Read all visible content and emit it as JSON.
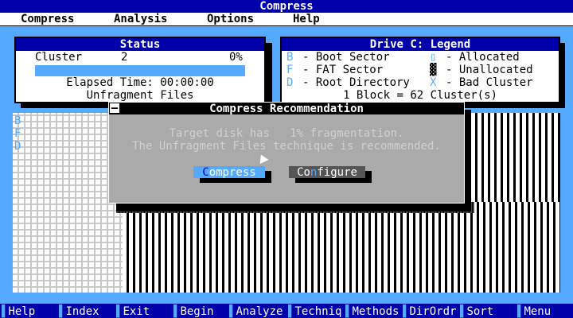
{
  "window": {
    "title": "Compress"
  },
  "menu": [
    {
      "label": "Compress"
    },
    {
      "label": "Analysis"
    },
    {
      "label": "Options"
    },
    {
      "label": "Help"
    }
  ],
  "status_panel": {
    "title": "Status",
    "cluster_label": "Cluster",
    "cluster_value": "2",
    "percent": "0%",
    "elapsed": "Elapsed Time: 00:00:00",
    "technique": "Unfragment Files"
  },
  "legend_panel": {
    "title": "Drive C: Legend",
    "items": [
      {
        "symbol": "B",
        "label": "- Boot Sector"
      },
      {
        "symbol": "F",
        "label": "- FAT Sector"
      },
      {
        "symbol": "D",
        "label": "- Root Directory"
      },
      {
        "symbol": "▯",
        "label": "- Allocated"
      },
      {
        "symbol": "▓",
        "label": "- Unallocated"
      },
      {
        "symbol": "X",
        "label": "- Bad Cluster"
      }
    ],
    "block_info": "1 Block = 62 Cluster(s)"
  },
  "disk_map": {
    "labels": [
      "B",
      "F",
      "D"
    ]
  },
  "dialog": {
    "title": "Compress Recommendation",
    "close_glyph": "—",
    "line1": "Target disk has   1% fragmentation.",
    "line2": "The Unfragment Files technique is recommended.",
    "compress_hot": "C",
    "compress_rest": "ompress",
    "configure_pre": "Co",
    "configure_hot": "n",
    "configure_rest": "figure"
  },
  "fkeys": [
    {
      "label": "Help"
    },
    {
      "label": "Index"
    },
    {
      "label": "Exit"
    },
    {
      "label": "Begin"
    },
    {
      "label": "Analyze"
    },
    {
      "label": "Techniq"
    },
    {
      "label": "Methods"
    },
    {
      "label": "DirOrdr"
    },
    {
      "label": "Sort"
    },
    {
      "label": "Menu"
    }
  ],
  "colors": {
    "desktop": "#55aaff",
    "title": "#0000aa",
    "dialog": "#aaaaaa"
  }
}
